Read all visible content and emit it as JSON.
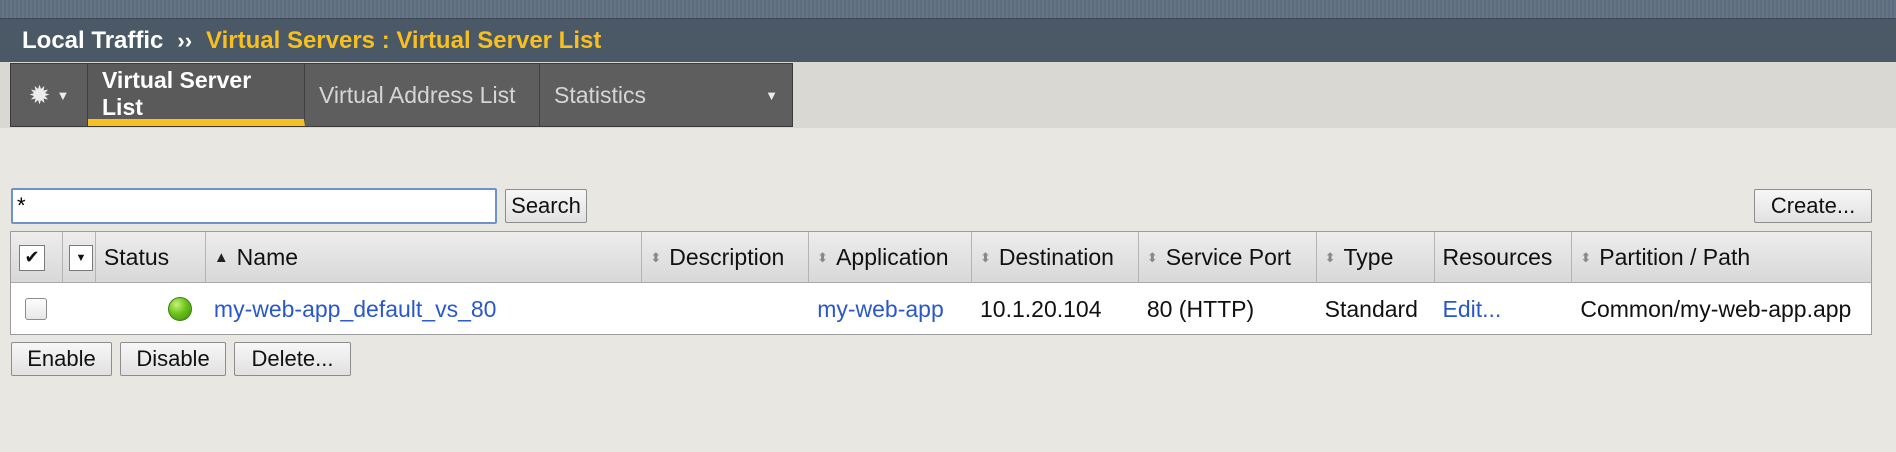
{
  "breadcrumb": {
    "root": "Local Traffic",
    "separator": "››",
    "current": "Virtual Servers : Virtual Server List"
  },
  "tabs": {
    "gear_icon": "gear-icon",
    "items": [
      {
        "label": "Virtual Server List",
        "active": true
      },
      {
        "label": "Virtual Address List",
        "active": false
      },
      {
        "label": "Statistics",
        "active": false
      }
    ]
  },
  "search": {
    "value": "*",
    "button_label": "Search"
  },
  "create_button_label": "Create...",
  "table": {
    "columns": [
      "Status",
      "Name",
      "Description",
      "Application",
      "Destination",
      "Service Port",
      "Type",
      "Resources",
      "Partition / Path"
    ],
    "rows": [
      {
        "status": "available",
        "name": "my-web-app_default_vs_80",
        "description": "",
        "application": "my-web-app",
        "destination": "10.1.20.104",
        "service_port": "80 (HTTP)",
        "type": "Standard",
        "resources": "Edit...",
        "partition_path": "Common/my-web-app.app"
      }
    ]
  },
  "actions": {
    "enable": "Enable",
    "disable": "Disable",
    "delete": "Delete..."
  },
  "colors": {
    "header_bg": "#4b5866",
    "accent_yellow": "#f7bf1f",
    "link_blue": "#2a58c9",
    "status_green": "#6cc21a"
  }
}
